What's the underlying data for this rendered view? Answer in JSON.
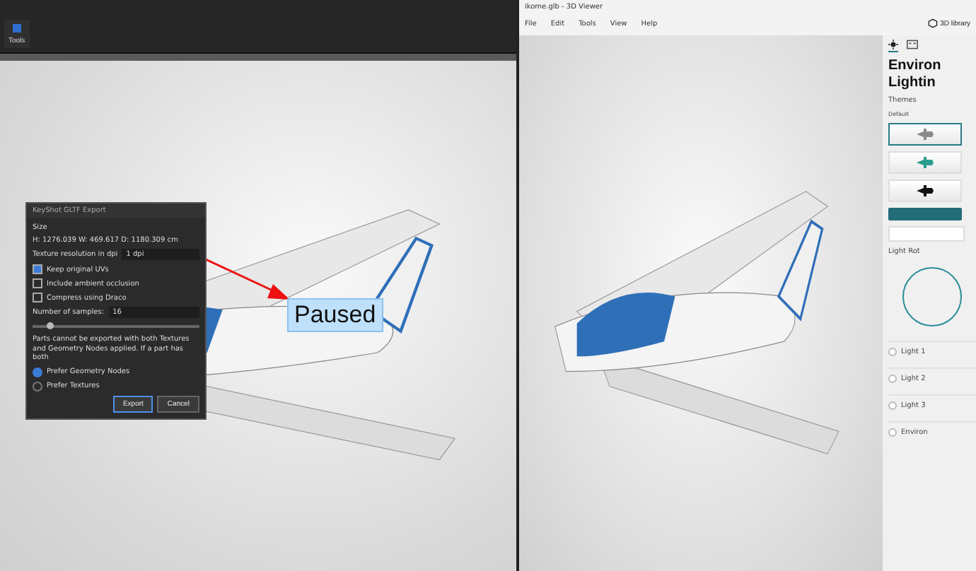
{
  "left_app": {
    "toolbar": [
      {
        "label": "Tools"
      }
    ]
  },
  "export_dialog": {
    "title": "KeyShot GLTF Export",
    "size_label": "Size",
    "size_value": "H: 1276.039 W: 469.617 D: 1180.309  cm",
    "texture_label": "Texture resolution in dpi",
    "texture_value": "1 dpi",
    "options": [
      {
        "label": "Keep original UVs",
        "checked": true
      },
      {
        "label": "Include ambient occlusion",
        "checked": false
      },
      {
        "label": "Compress using Draco",
        "checked": false
      }
    ],
    "samples_label": "Number of samples:",
    "samples_value": "16",
    "samples_slider": {
      "level": 0.1
    },
    "note": "Parts cannot be exported with both Textures and Geometry Nodes applied. If a part has both",
    "preferences": [
      {
        "label": "Prefer Geometry Nodes",
        "selected": true
      },
      {
        "label": "Prefer Textures",
        "selected": false
      }
    ],
    "buttons": [
      {
        "label": "Export",
        "kind": "primary"
      },
      {
        "label": "Cancel",
        "kind": "secondary"
      }
    ]
  },
  "paused_label": "Paused",
  "viewer": {
    "title": "ikome.glb - 3D Viewer",
    "menu": [
      "File",
      "Edit",
      "Tools",
      "View",
      "Help"
    ],
    "library_button": "3D library",
    "sidebar": {
      "tabs": [
        {
          "kind": "sun",
          "selected": true
        },
        {
          "kind": "panel",
          "selected": false
        }
      ],
      "heading": [
        "Environ",
        "Lightin"
      ],
      "themes_label": "Themes",
      "default_label": "Default",
      "themes": [
        {
          "kind": "light",
          "selected": true
        },
        {
          "kind": "teal",
          "selected": false
        },
        {
          "kind": "dark",
          "selected": false
        }
      ],
      "rotation_label": "Light Rot",
      "lights": [
        {
          "label": "Light 1",
          "checked": false
        },
        {
          "label": "Light 2",
          "checked": false
        },
        {
          "label": "Light 3",
          "checked": false
        },
        {
          "label": "Environ",
          "checked": false
        }
      ]
    }
  }
}
